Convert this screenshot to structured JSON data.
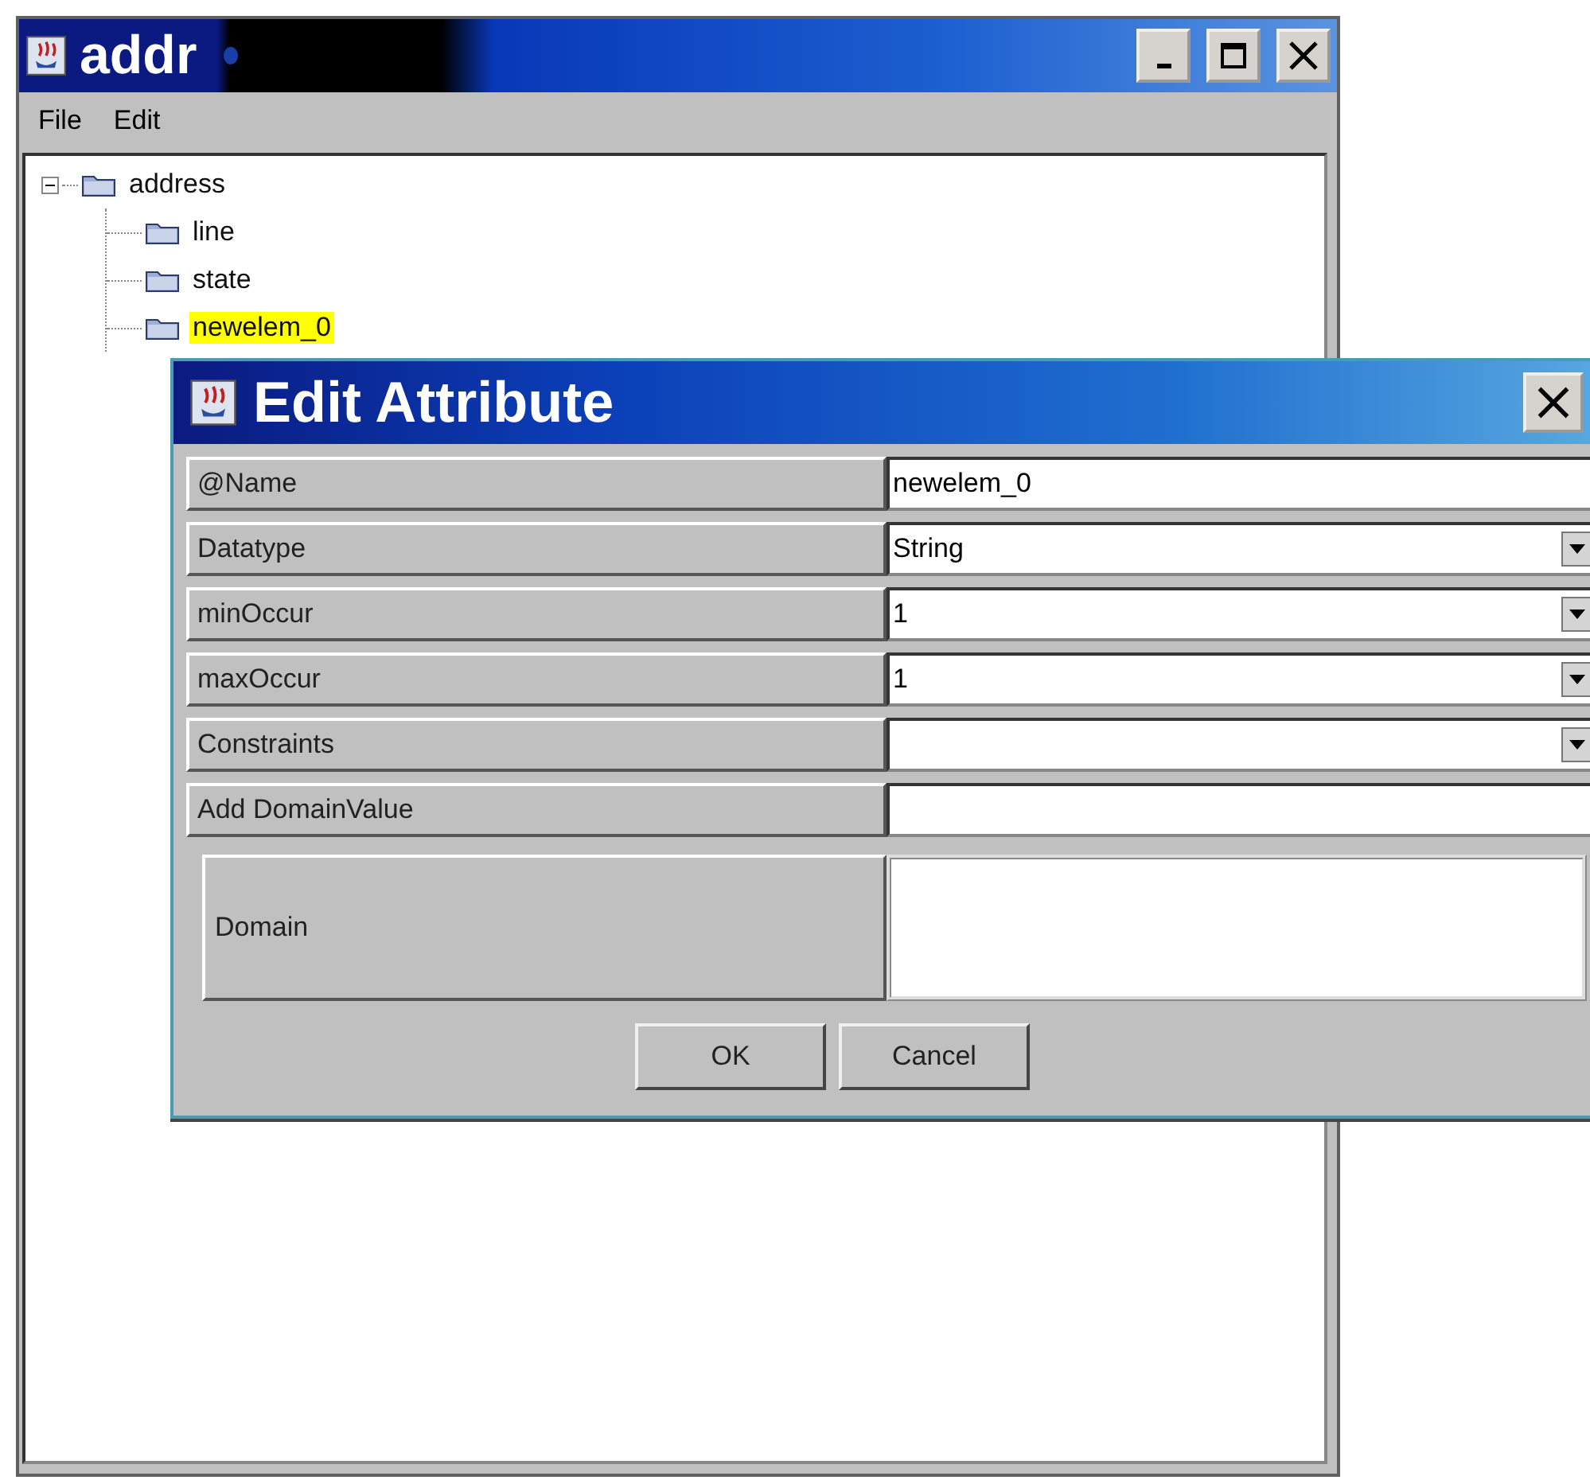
{
  "main_window": {
    "title": "addr",
    "menu": [
      "File",
      "Edit"
    ],
    "tree": [
      {
        "label": "address",
        "expanded": true,
        "selected": false,
        "children": [
          {
            "label": "line",
            "selected": false
          },
          {
            "label": "state",
            "selected": false
          },
          {
            "label": "newelem_0",
            "selected": true
          }
        ]
      }
    ]
  },
  "dialog": {
    "title": "Edit Attribute",
    "rows": [
      {
        "label": "@Name",
        "kind": "text",
        "value": "newelem_0"
      },
      {
        "label": "Datatype",
        "kind": "dropdown",
        "value": "String"
      },
      {
        "label": "minOccur",
        "kind": "dropdown",
        "value": "1"
      },
      {
        "label": "maxOccur",
        "kind": "dropdown",
        "value": "1"
      },
      {
        "label": "Constraints",
        "kind": "dropdown"
      },
      {
        "label": "Add DomainValue",
        "kind": "text"
      },
      {
        "label": "Domain",
        "kind": "list"
      }
    ],
    "buttons": [
      "OK",
      "Cancel"
    ]
  }
}
